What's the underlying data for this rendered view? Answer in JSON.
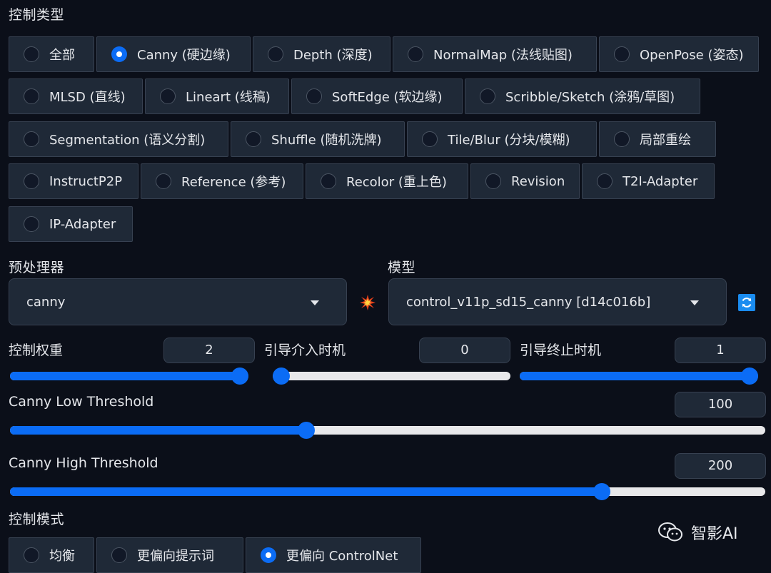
{
  "control_type": {
    "title": "控制类型",
    "options": [
      {
        "label": "全部",
        "selected": false
      },
      {
        "label": "Canny (硬边缘)",
        "selected": true
      },
      {
        "label": "Depth (深度)",
        "selected": false
      },
      {
        "label": "NormalMap (法线贴图)",
        "selected": false
      },
      {
        "label": "OpenPose (姿态)",
        "selected": false
      },
      {
        "label": "MLSD (直线)",
        "selected": false
      },
      {
        "label": "Lineart (线稿)",
        "selected": false
      },
      {
        "label": "SoftEdge (软边缘)",
        "selected": false
      },
      {
        "label": "Scribble/Sketch (涂鸦/草图)",
        "selected": false
      },
      {
        "label": "Segmentation (语义分割)",
        "selected": false
      },
      {
        "label": "Shuffle (随机洗牌)",
        "selected": false
      },
      {
        "label": "Tile/Blur (分块/模糊)",
        "selected": false
      },
      {
        "label": "局部重绘",
        "selected": false
      },
      {
        "label": "InstructP2P",
        "selected": false
      },
      {
        "label": "Reference (参考)",
        "selected": false
      },
      {
        "label": "Recolor (重上色)",
        "selected": false
      },
      {
        "label": "Revision",
        "selected": false
      },
      {
        "label": "T2I-Adapter",
        "selected": false
      },
      {
        "label": "IP-Adapter",
        "selected": false
      }
    ]
  },
  "preprocessor": {
    "title": "预处理器",
    "value": "canny"
  },
  "model": {
    "title": "模型",
    "value": "control_v11p_sd15_canny [d14c016b]"
  },
  "sliders": {
    "control_weight": {
      "label": "控制权重",
      "value": "2",
      "fraction": 1.0
    },
    "guidance_start": {
      "label": "引导介入时机",
      "value": "0",
      "fraction": 0.0
    },
    "guidance_end": {
      "label": "引导终止时机",
      "value": "1",
      "fraction": 1.0
    },
    "canny_low": {
      "label": "Canny Low Threshold",
      "value": "100",
      "fraction": 0.392
    },
    "canny_high": {
      "label": "Canny High Threshold",
      "value": "200",
      "fraction": 0.784
    }
  },
  "control_mode": {
    "title": "控制模式",
    "options": [
      {
        "label": "均衡",
        "selected": false
      },
      {
        "label": "更偏向提示词",
        "selected": false
      },
      {
        "label": "更偏向 ControlNet",
        "selected": true
      }
    ]
  },
  "watermark": {
    "text": "智影AI"
  },
  "icons": {
    "run_preprocessor": "explosion-icon",
    "refresh_models": "refresh-icon",
    "caret": "chevron-down-icon",
    "watermark": "wechat-icon"
  },
  "colors": {
    "accent": "#0b6cf5",
    "background": "#0b0f19",
    "panel": "#1f2937"
  }
}
